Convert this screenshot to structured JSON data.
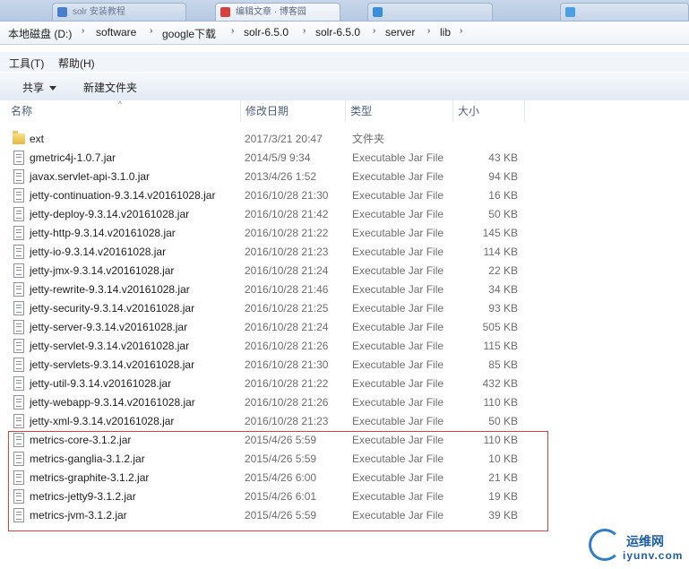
{
  "window": {
    "background_tabs": [
      {
        "label": "solr 安装教程",
        "icon_color": "#4a7fd0"
      },
      {
        "label": "编辑文章 · 博客园",
        "icon_color": "#d9413f"
      },
      {
        "label": "",
        "icon_color": "#3a8fd8"
      },
      {
        "label": "",
        "icon_color": "#4aa0e0"
      }
    ]
  },
  "address": {
    "crumbs": [
      "本地磁盘 (D:)",
      "software",
      "google下载",
      "solr-6.5.0",
      "solr-6.5.0",
      "server",
      "lib"
    ],
    "separator": "›"
  },
  "menu": {
    "tools": "工具(T)",
    "help": "帮助(H)"
  },
  "toolbar": {
    "share": "共享",
    "new_folder": "新建文件夹"
  },
  "columns": {
    "name": "名称",
    "date": "修改日期",
    "type": "类型",
    "size": "大小"
  },
  "files": [
    {
      "name": "ext",
      "date": "2017/3/21 20:47",
      "type": "文件夹",
      "size": "",
      "is_folder": true
    },
    {
      "name": "gmetric4j-1.0.7.jar",
      "date": "2014/5/9 9:34",
      "type": "Executable Jar File",
      "size": "43 KB"
    },
    {
      "name": "javax.servlet-api-3.1.0.jar",
      "date": "2013/4/26 1:52",
      "type": "Executable Jar File",
      "size": "94 KB"
    },
    {
      "name": "jetty-continuation-9.3.14.v20161028.jar",
      "date": "2016/10/28 21:30",
      "type": "Executable Jar File",
      "size": "16 KB"
    },
    {
      "name": "jetty-deploy-9.3.14.v20161028.jar",
      "date": "2016/10/28 21:42",
      "type": "Executable Jar File",
      "size": "50 KB"
    },
    {
      "name": "jetty-http-9.3.14.v20161028.jar",
      "date": "2016/10/28 21:22",
      "type": "Executable Jar File",
      "size": "145 KB"
    },
    {
      "name": "jetty-io-9.3.14.v20161028.jar",
      "date": "2016/10/28 21:23",
      "type": "Executable Jar File",
      "size": "114 KB"
    },
    {
      "name": "jetty-jmx-9.3.14.v20161028.jar",
      "date": "2016/10/28 21:24",
      "type": "Executable Jar File",
      "size": "22 KB"
    },
    {
      "name": "jetty-rewrite-9.3.14.v20161028.jar",
      "date": "2016/10/28 21:46",
      "type": "Executable Jar File",
      "size": "34 KB"
    },
    {
      "name": "jetty-security-9.3.14.v20161028.jar",
      "date": "2016/10/28 21:25",
      "type": "Executable Jar File",
      "size": "93 KB"
    },
    {
      "name": "jetty-server-9.3.14.v20161028.jar",
      "date": "2016/10/28 21:24",
      "type": "Executable Jar File",
      "size": "505 KB"
    },
    {
      "name": "jetty-servlet-9.3.14.v20161028.jar",
      "date": "2016/10/28 21:26",
      "type": "Executable Jar File",
      "size": "115 KB"
    },
    {
      "name": "jetty-servlets-9.3.14.v20161028.jar",
      "date": "2016/10/28 21:30",
      "type": "Executable Jar File",
      "size": "85 KB"
    },
    {
      "name": "jetty-util-9.3.14.v20161028.jar",
      "date": "2016/10/28 21:22",
      "type": "Executable Jar File",
      "size": "432 KB"
    },
    {
      "name": "jetty-webapp-9.3.14.v20161028.jar",
      "date": "2016/10/28 21:26",
      "type": "Executable Jar File",
      "size": "110 KB"
    },
    {
      "name": "jetty-xml-9.3.14.v20161028.jar",
      "date": "2016/10/28 21:23",
      "type": "Executable Jar File",
      "size": "50 KB"
    },
    {
      "name": "metrics-core-3.1.2.jar",
      "date": "2015/4/26 5:59",
      "type": "Executable Jar File",
      "size": "110 KB"
    },
    {
      "name": "metrics-ganglia-3.1.2.jar",
      "date": "2015/4/26 5:59",
      "type": "Executable Jar File",
      "size": "10 KB"
    },
    {
      "name": "metrics-graphite-3.1.2.jar",
      "date": "2015/4/26 6:00",
      "type": "Executable Jar File",
      "size": "21 KB"
    },
    {
      "name": "metrics-jetty9-3.1.2.jar",
      "date": "2015/4/26 6:01",
      "type": "Executable Jar File",
      "size": "19 KB"
    },
    {
      "name": "metrics-jvm-3.1.2.jar",
      "date": "2015/4/26 5:59",
      "type": "Executable Jar File",
      "size": "39 KB"
    }
  ],
  "highlight_color": "#d9413f",
  "watermark": {
    "cn": "运维网",
    "en": "iyunv.com"
  }
}
